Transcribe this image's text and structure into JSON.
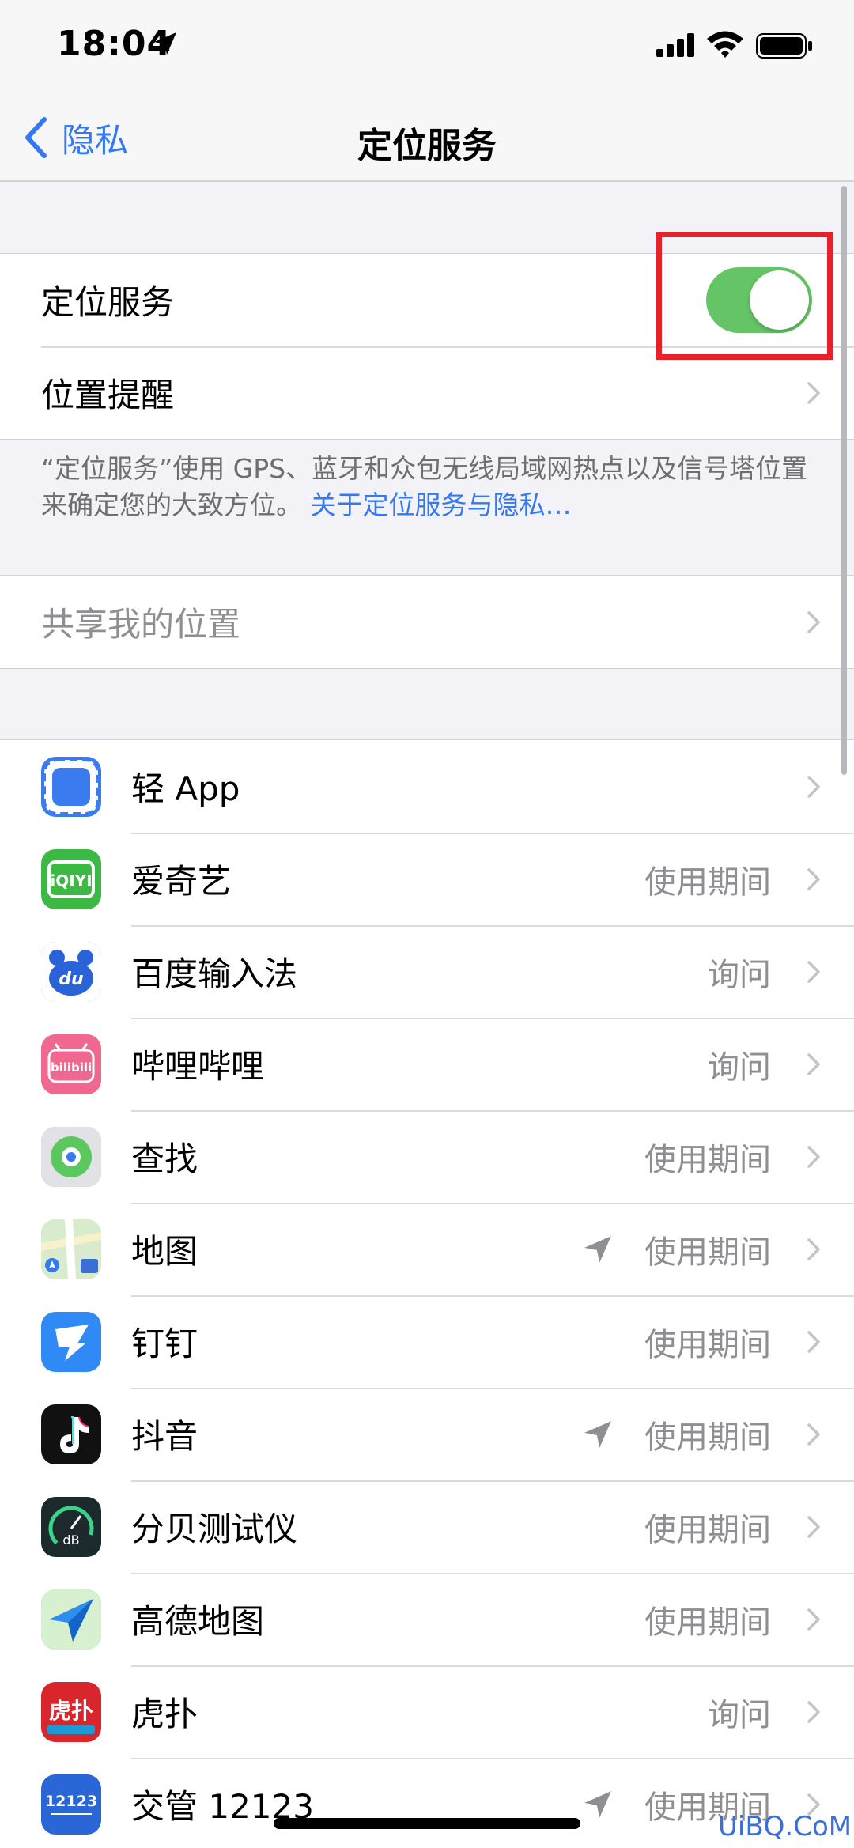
{
  "status_bar": {
    "time": "18:04"
  },
  "nav": {
    "back_label": "隐私",
    "title": "定位服务"
  },
  "location_services": {
    "label": "定位服务",
    "enabled": true
  },
  "location_alerts": {
    "label": "位置提醒"
  },
  "footer": {
    "text": "“定位服务”使用 GPS、蓝牙和众包无线局域网热点以及信号塔位置来确定您的大致方位。",
    "link": "关于定位服务与隐私…"
  },
  "share_location": {
    "label": "共享我的位置"
  },
  "apps": [
    {
      "name": "轻 App",
      "status": "",
      "location_used": false,
      "icon": "light-app-icon",
      "color": "#3a7bf0"
    },
    {
      "name": "爱奇艺",
      "status": "使用期间",
      "location_used": false,
      "icon": "iqiyi-icon",
      "color": "#3cb944"
    },
    {
      "name": "百度输入法",
      "status": "询问",
      "location_used": false,
      "icon": "baidu-input-icon",
      "color": "#2a63d8"
    },
    {
      "name": "哔哩哔哩",
      "status": "询问",
      "location_used": false,
      "icon": "bilibili-icon",
      "color": "#f0688f"
    },
    {
      "name": "查找",
      "status": "使用期间",
      "location_used": false,
      "icon": "find-my-icon",
      "color": "#34c759"
    },
    {
      "name": "地图",
      "status": "使用期间",
      "location_used": true,
      "icon": "maps-icon",
      "color": "#8bd28d"
    },
    {
      "name": "钉钉",
      "status": "使用期间",
      "location_used": false,
      "icon": "dingtalk-icon",
      "color": "#2f8af5"
    },
    {
      "name": "抖音",
      "status": "使用期间",
      "location_used": true,
      "icon": "douyin-icon",
      "color": "#111111"
    },
    {
      "name": "分贝测试仪",
      "status": "使用期间",
      "location_used": false,
      "icon": "decibel-meter-icon",
      "color": "#1c2a2e"
    },
    {
      "name": "高德地图",
      "status": "使用期间",
      "location_used": false,
      "icon": "amap-icon",
      "color": "#2e8ef0"
    },
    {
      "name": "虎扑",
      "status": "询问",
      "location_used": false,
      "icon": "hupu-icon",
      "color": "#d8262c"
    },
    {
      "name": "交管 12123",
      "status": "使用期间",
      "location_used": true,
      "icon": "traffic-12123-icon",
      "color": "#2a66d6"
    }
  ],
  "watermark": "UiBQ.CoM"
}
